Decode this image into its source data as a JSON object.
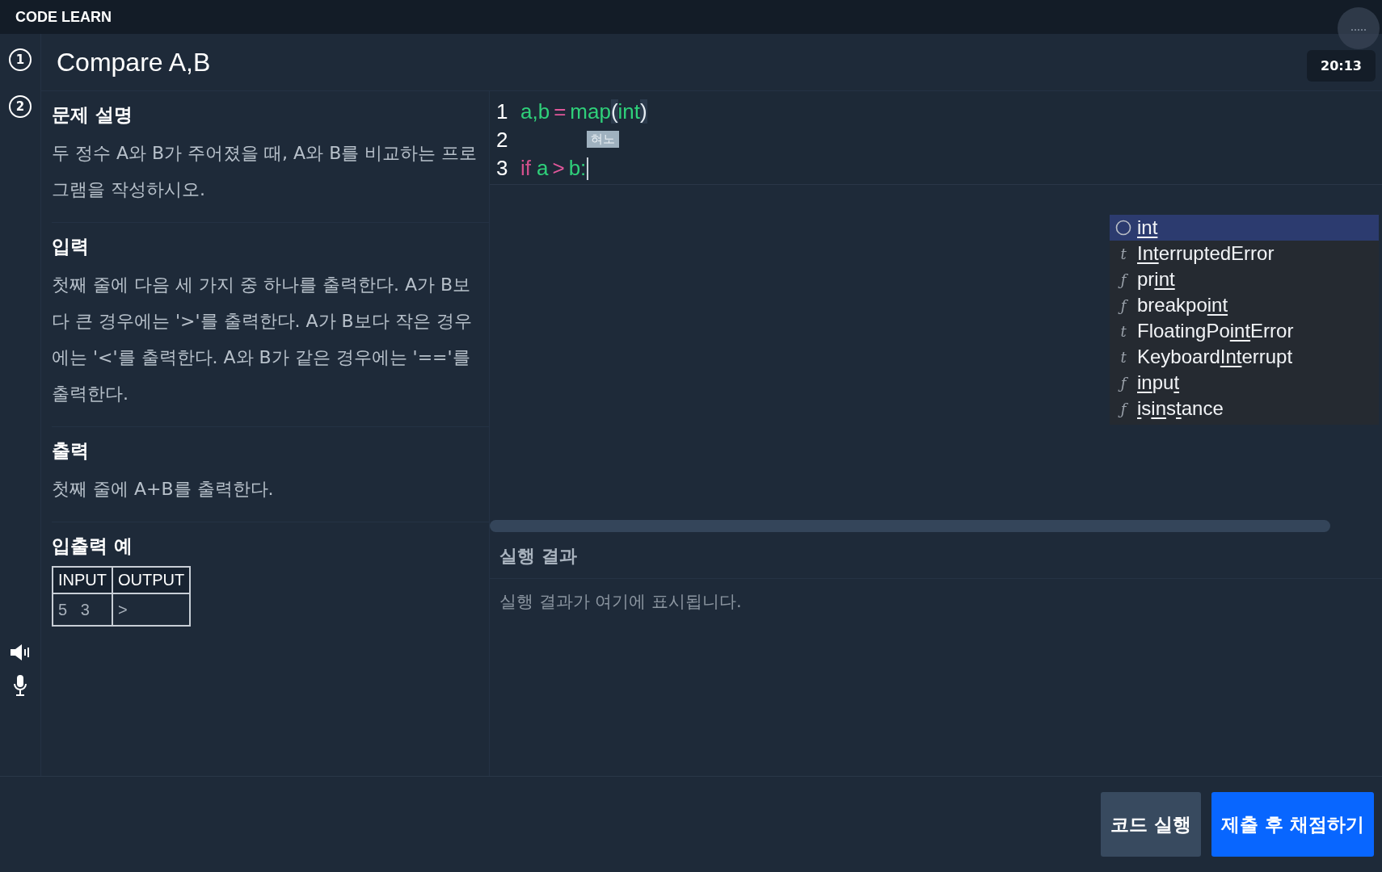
{
  "app": {
    "title": "CODE LEARN"
  },
  "steps": [
    {
      "label": "1"
    },
    {
      "label": "2"
    }
  ],
  "problem_title": "Compare A,B",
  "timer": "20:13",
  "sections": [
    {
      "heading": "문제 설명",
      "text": "두 정수 A와 B가 주어졌을 때, A와 B를 비교하는 프로그램을 작성하시오."
    },
    {
      "heading": "입력",
      "text": "첫째 줄에 다음 세 가지 중 하나를 출력한다. A가 B보다 큰 경우에는 '>'를 출력한다. A가 B보다 작은 경우에는 '<'를 출력한다. A와 B가 같은 경우에는 '=='를 출력한다."
    },
    {
      "heading": "출력",
      "text": "첫째 줄에 A+B를 출력한다."
    }
  ],
  "example": {
    "heading": "입출력 예",
    "columns": [
      "INPUT",
      "OUTPUT"
    ],
    "rows": [
      [
        "5   3",
        ">"
      ]
    ]
  },
  "editor": {
    "lines": [
      {
        "number": "1",
        "tokens": [
          {
            "text": "a,b",
            "kind": "name"
          },
          {
            "text": "=",
            "kind": "operator"
          },
          {
            "text": "map",
            "kind": "name"
          },
          {
            "text": "(",
            "kind": "bracket"
          },
          {
            "text": "int",
            "kind": "name"
          },
          {
            "text": ")",
            "kind": "bracket"
          }
        ]
      },
      {
        "number": "2"
      },
      {
        "number": "3",
        "tokens": [
          {
            "text": "if",
            "kind": "keyword"
          },
          {
            "text": "a",
            "kind": "name"
          },
          {
            "text": ">",
            "kind": "operator"
          },
          {
            "text": "b:",
            "kind": "name"
          }
        ]
      }
    ],
    "ime_hint": "혀노",
    "suggestions": [
      {
        "kind": "keyword",
        "selected": true,
        "parts": [
          {
            "text": "int",
            "match": true
          }
        ]
      },
      {
        "kind": "type",
        "glyph": "t",
        "selected": false,
        "parts": [
          {
            "text": "Int",
            "match": true
          },
          {
            "text": "erruptedError",
            "match": false
          }
        ]
      },
      {
        "kind": "function",
        "glyph": "ƒ",
        "selected": false,
        "parts": [
          {
            "text": "pr",
            "match": false
          },
          {
            "text": "int",
            "match": true
          }
        ]
      },
      {
        "kind": "function",
        "glyph": "ƒ",
        "selected": false,
        "parts": [
          {
            "text": "breakpo",
            "match": false
          },
          {
            "text": "int",
            "match": true
          }
        ]
      },
      {
        "kind": "type",
        "glyph": "t",
        "selected": false,
        "parts": [
          {
            "text": "FloatingPo",
            "match": false
          },
          {
            "text": "int",
            "match": true
          },
          {
            "text": "Error",
            "match": false
          }
        ]
      },
      {
        "kind": "type",
        "glyph": "t",
        "selected": false,
        "parts": [
          {
            "text": "Keyboard",
            "match": false
          },
          {
            "text": "Int",
            "match": true
          },
          {
            "text": "errupt",
            "match": false
          }
        ]
      },
      {
        "kind": "function",
        "glyph": "ƒ",
        "selected": false,
        "parts": [
          {
            "text": "in",
            "match": true
          },
          {
            "text": "pu",
            "match": false
          },
          {
            "text": "t",
            "match": true
          }
        ]
      },
      {
        "kind": "function",
        "glyph": "ƒ",
        "selected": false,
        "parts": [
          {
            "text": "i",
            "match": true
          },
          {
            "text": "s",
            "match": false
          },
          {
            "text": "in",
            "match": true
          },
          {
            "text": "s",
            "match": false
          },
          {
            "text": "t",
            "match": true
          },
          {
            "text": "ance",
            "match": false
          }
        ]
      }
    ]
  },
  "result": {
    "heading": "실행 결과",
    "placeholder": "실행 결과가 여기에 표시됩니다."
  },
  "buttons": [
    {
      "label": "코드 실행",
      "kind": "secondary"
    },
    {
      "label": "제출 후 채점하기",
      "kind": "primary"
    }
  ]
}
